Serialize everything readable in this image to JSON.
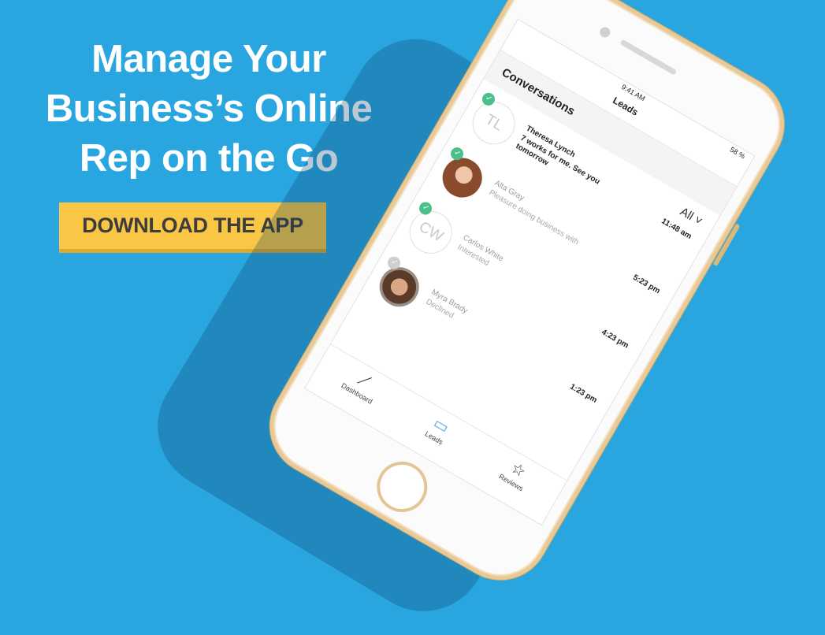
{
  "banner": {
    "headline_lines": [
      "Manage Your",
      "Business’s Online",
      "Rep on the Go"
    ],
    "cta_label": "DOWNLOAD THE APP"
  },
  "phone": {
    "status_time": "9:41 AM",
    "battery": "58 %",
    "nav_title": "Leads",
    "section_title": "Conversations",
    "filter_label": "All ˅",
    "conversations": [
      {
        "initials": "TL",
        "name": "Theresa Lynch",
        "message": "7 works for me. See you tomorrow",
        "time": "11:48 am"
      },
      {
        "initials": "",
        "name": "Alta Gray",
        "message": "Pleasure doing business with",
        "time": "5:23 pm"
      },
      {
        "initials": "CW",
        "name": "Carlos White",
        "message": "Interested",
        "time": "4:23 pm"
      },
      {
        "initials": "",
        "name": "Myra Brady",
        "message": "Declined",
        "time": "1:23 pm"
      }
    ],
    "tabs": [
      {
        "label": "Dashboard",
        "icon": "chart-icon"
      },
      {
        "label": "Leads",
        "icon": "chat-icon"
      },
      {
        "label": "Reviews",
        "icon": "star-icon"
      }
    ]
  },
  "colors": {
    "background": "#29a6df",
    "cta": "#f9c646",
    "check": "#4cc08a"
  }
}
